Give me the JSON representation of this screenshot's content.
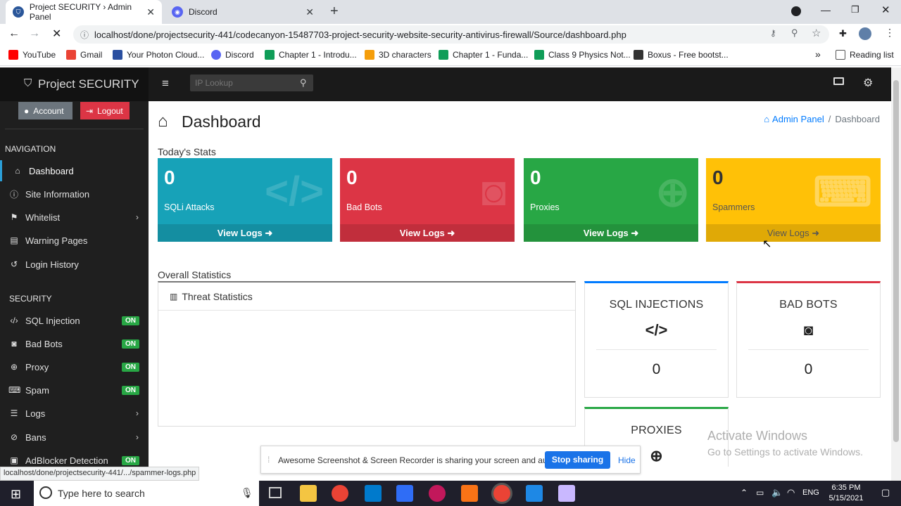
{
  "browser": {
    "tabs": [
      {
        "title": "Project SECURITY › Admin Panel",
        "active": true
      },
      {
        "title": "Discord",
        "active": false
      }
    ],
    "url": "localhost/done/projectsecurity-441/codecanyon-15487703-project-security-website-security-antivirus-firewall/Source/dashboard.php",
    "bookmarks": [
      "YouTube",
      "Gmail",
      "Your Photon Cloud...",
      "Discord",
      "Chapter 1 - Introdu...",
      "3D characters",
      "Chapter 1 - Funda...",
      "Class 9 Physics Not...",
      "Boxus - Free bootst..."
    ],
    "reading_list": "Reading list",
    "more_bookmarks": "»"
  },
  "header": {
    "brand": "Project SECURITY",
    "search_placeholder": "IP Lookup"
  },
  "sidebar": {
    "account_label": "Account",
    "logout_label": "Logout",
    "navigation_heading": "NAVIGATION",
    "security_heading": "SECURITY",
    "nav_items": [
      {
        "label": "Dashboard",
        "icon": "home-icon"
      },
      {
        "label": "Site Information",
        "icon": "info-icon"
      },
      {
        "label": "Whitelist",
        "icon": "flag-icon"
      },
      {
        "label": "Warning Pages",
        "icon": "file-icon"
      },
      {
        "label": "Login History",
        "icon": "history-icon"
      }
    ],
    "security_items": [
      {
        "label": "SQL Injection",
        "status": "ON"
      },
      {
        "label": "Bad Bots",
        "status": "ON"
      },
      {
        "label": "Proxy",
        "status": "ON"
      },
      {
        "label": "Spam",
        "status": "ON"
      },
      {
        "label": "Logs",
        "status": ""
      },
      {
        "label": "Bans",
        "status": ""
      },
      {
        "label": "AdBlocker Detection",
        "status": "ON"
      }
    ]
  },
  "main": {
    "page_title": "Dashboard",
    "breadcrumb": {
      "root": "Admin Panel",
      "separator": "/",
      "current": "Dashboard"
    },
    "todays_stats_heading": "Today's Stats",
    "stats": [
      {
        "value": "0",
        "label": "SQLi Attacks",
        "link": "View Logs",
        "color": "#17a2b8"
      },
      {
        "value": "0",
        "label": "Bad Bots",
        "link": "View Logs",
        "color": "#dc3545"
      },
      {
        "value": "0",
        "label": "Proxies",
        "link": "View Logs",
        "color": "#28a745"
      },
      {
        "value": "0",
        "label": "Spammers",
        "link": "View Logs",
        "color": "#ffc107"
      }
    ],
    "overall_heading": "Overall Statistics",
    "threat_title": "Threat Statistics",
    "summary_cards": [
      {
        "title": "SQL INJECTIONS",
        "value": "0",
        "accent": "#007bff"
      },
      {
        "title": "BAD BOTS",
        "value": "0",
        "accent": "#dc3545"
      },
      {
        "title": "PROXIES",
        "value": "",
        "accent": "#28a745"
      }
    ]
  },
  "overlay": {
    "share_text": "Awesome Screenshot & Screen Recorder is sharing your screen and audio.",
    "stop_label": "Stop sharing",
    "hide_label": "Hide",
    "watermark_title": "Activate Windows",
    "watermark_sub": "Go to Settings to activate Windows.",
    "status_url": "localhost/done/projectsecurity-441/.../spammer-logs.php"
  },
  "taskbar": {
    "search_placeholder": "Type here to search",
    "time": "6:35 PM",
    "date": "5/15/2021",
    "lang": "ENG"
  }
}
